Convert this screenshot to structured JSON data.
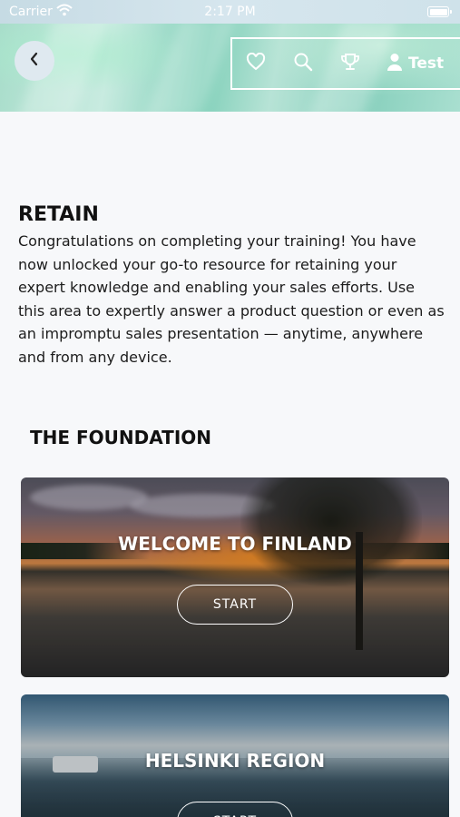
{
  "status_bar": {
    "carrier": "Carrier",
    "time": "2:17 PM"
  },
  "header": {
    "user_label": "Test",
    "icons": [
      "back-chevron-icon",
      "heart-icon",
      "search-icon",
      "trophy-icon",
      "user-icon"
    ]
  },
  "section": {
    "title": "RETAIN",
    "body": "Congratulations on completing your training! You have now unlocked your go-to resource for retaining your expert knowledge and enabling your sales efforts. Use this area to expertly answer a product question or even as an impromptu sales presentation — anytime, anywhere and from any device."
  },
  "foundation": {
    "heading": "THE FOUNDATION",
    "cards": [
      {
        "title": "WELCOME TO FINLAND",
        "button": "START"
      },
      {
        "title": "HELSINKI REGION",
        "button": "START"
      }
    ]
  },
  "colors": {
    "background": "#f7f8fa",
    "header_tint": "#a6dcc9",
    "text": "#111111",
    "card_text": "#ffffff"
  }
}
